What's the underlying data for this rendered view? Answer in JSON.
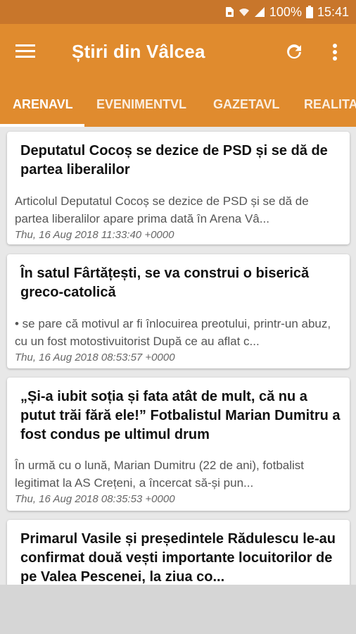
{
  "status_bar": {
    "battery": "100%",
    "time": "15:41"
  },
  "app_bar": {
    "title": "Știri din Vâlcea"
  },
  "tabs": [
    {
      "label": "ARENAVL",
      "selected": true
    },
    {
      "label": "EVENIMENTVL",
      "selected": false
    },
    {
      "label": "GAZETAVL",
      "selected": false
    },
    {
      "label": "REALITA",
      "selected": false
    }
  ],
  "articles": [
    {
      "title": "Deputatul Cocoș se dezice de PSD și se dă de partea liberalilor",
      "summary": "Articolul Deputatul Cocoș se dezice de PSD și se dă de partea liberalilor apare prima dată în Arena Vâ...",
      "date": "Thu, 16 Aug 2018 11:33:40 +0000"
    },
    {
      "title": "În satul Fârtățești, se va construi o biserică greco-catolică",
      "summary": "• se pare că motivul ar fi înlocuirea preotului, printr-un abuz, cu un fost motostivuitorist  După ce au aflat c...",
      "date": "Thu, 16 Aug 2018 08:53:57 +0000"
    },
    {
      "title": "„Și-a iubit soția și fata atât de mult, că nu a putut trăi fără ele!” Fotbalistul Marian Dumitru a fost condus pe ultimul drum",
      "summary": "În urmă cu o lună, Marian Dumitru (22 de ani), fotbalist legitimat la AS Crețeni, a încercat să-și pun...",
      "date": "Thu, 16 Aug 2018 08:35:53 +0000"
    },
    {
      "title": "Primarul Vasile și președintele Rădulescu le-au confirmat două vești importante locuitorilor de pe Valea Pescenei, la ziua co...",
      "summary": "",
      "date": ""
    }
  ],
  "colors": {
    "status_bar": "#c8762b",
    "app_bar": "#e08b2e",
    "background": "#e8e8e8"
  }
}
